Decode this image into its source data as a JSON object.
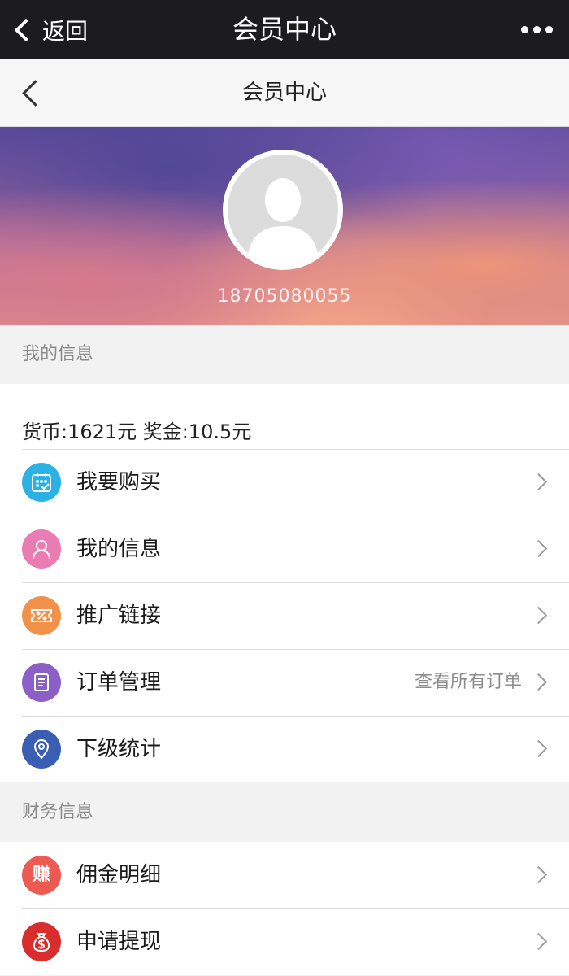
{
  "wechat_bar": {
    "back_label": "返回",
    "title": "会员中心"
  },
  "page_header": {
    "title": "会员中心"
  },
  "profile": {
    "phone": "18705080055"
  },
  "my_info": {
    "section_title": "我的信息",
    "balance": "货币:1621元  奖金:10.5元",
    "items": [
      {
        "label": "我要购买",
        "icon": "calendar-icon",
        "color": "#2bb1e3",
        "extra": ""
      },
      {
        "label": "我的信息",
        "icon": "user-icon",
        "color": "#ea7cb4",
        "extra": ""
      },
      {
        "label": "推广链接",
        "icon": "coupon-icon",
        "color": "#f2914a",
        "extra": ""
      },
      {
        "label": "订单管理",
        "icon": "document-icon",
        "color": "#8b5fc6",
        "extra": "查看所有订单"
      },
      {
        "label": "下级统计",
        "icon": "location-pin-icon",
        "color": "#3a5fb2",
        "extra": ""
      }
    ]
  },
  "finance_info": {
    "section_title": "财务信息",
    "items": [
      {
        "label": "佣金明细",
        "icon": "earn-icon",
        "icon_text": "赚",
        "color": "#ec5a52",
        "extra": ""
      },
      {
        "label": "申请提现",
        "icon": "money-bag-icon",
        "color": "#d92d2d",
        "extra": ""
      }
    ]
  }
}
